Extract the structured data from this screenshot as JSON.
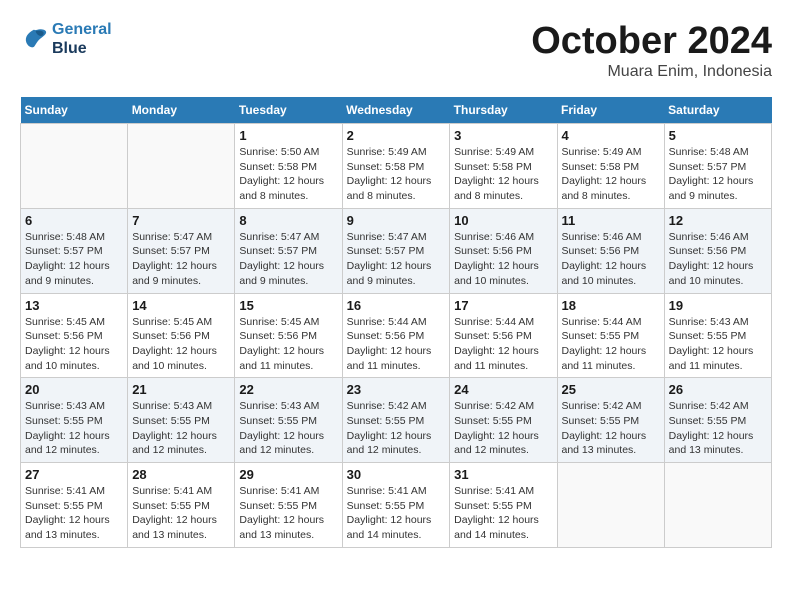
{
  "header": {
    "logo_line1": "General",
    "logo_line2": "Blue",
    "month": "October 2024",
    "location": "Muara Enim, Indonesia"
  },
  "weekdays": [
    "Sunday",
    "Monday",
    "Tuesday",
    "Wednesday",
    "Thursday",
    "Friday",
    "Saturday"
  ],
  "weeks": [
    [
      {
        "day": "",
        "info": ""
      },
      {
        "day": "",
        "info": ""
      },
      {
        "day": "1",
        "info": "Sunrise: 5:50 AM\nSunset: 5:58 PM\nDaylight: 12 hours and 8 minutes."
      },
      {
        "day": "2",
        "info": "Sunrise: 5:49 AM\nSunset: 5:58 PM\nDaylight: 12 hours and 8 minutes."
      },
      {
        "day": "3",
        "info": "Sunrise: 5:49 AM\nSunset: 5:58 PM\nDaylight: 12 hours and 8 minutes."
      },
      {
        "day": "4",
        "info": "Sunrise: 5:49 AM\nSunset: 5:58 PM\nDaylight: 12 hours and 8 minutes."
      },
      {
        "day": "5",
        "info": "Sunrise: 5:48 AM\nSunset: 5:57 PM\nDaylight: 12 hours and 9 minutes."
      }
    ],
    [
      {
        "day": "6",
        "info": "Sunrise: 5:48 AM\nSunset: 5:57 PM\nDaylight: 12 hours and 9 minutes."
      },
      {
        "day": "7",
        "info": "Sunrise: 5:47 AM\nSunset: 5:57 PM\nDaylight: 12 hours and 9 minutes."
      },
      {
        "day": "8",
        "info": "Sunrise: 5:47 AM\nSunset: 5:57 PM\nDaylight: 12 hours and 9 minutes."
      },
      {
        "day": "9",
        "info": "Sunrise: 5:47 AM\nSunset: 5:57 PM\nDaylight: 12 hours and 9 minutes."
      },
      {
        "day": "10",
        "info": "Sunrise: 5:46 AM\nSunset: 5:56 PM\nDaylight: 12 hours and 10 minutes."
      },
      {
        "day": "11",
        "info": "Sunrise: 5:46 AM\nSunset: 5:56 PM\nDaylight: 12 hours and 10 minutes."
      },
      {
        "day": "12",
        "info": "Sunrise: 5:46 AM\nSunset: 5:56 PM\nDaylight: 12 hours and 10 minutes."
      }
    ],
    [
      {
        "day": "13",
        "info": "Sunrise: 5:45 AM\nSunset: 5:56 PM\nDaylight: 12 hours and 10 minutes."
      },
      {
        "day": "14",
        "info": "Sunrise: 5:45 AM\nSunset: 5:56 PM\nDaylight: 12 hours and 10 minutes."
      },
      {
        "day": "15",
        "info": "Sunrise: 5:45 AM\nSunset: 5:56 PM\nDaylight: 12 hours and 11 minutes."
      },
      {
        "day": "16",
        "info": "Sunrise: 5:44 AM\nSunset: 5:56 PM\nDaylight: 12 hours and 11 minutes."
      },
      {
        "day": "17",
        "info": "Sunrise: 5:44 AM\nSunset: 5:56 PM\nDaylight: 12 hours and 11 minutes."
      },
      {
        "day": "18",
        "info": "Sunrise: 5:44 AM\nSunset: 5:55 PM\nDaylight: 12 hours and 11 minutes."
      },
      {
        "day": "19",
        "info": "Sunrise: 5:43 AM\nSunset: 5:55 PM\nDaylight: 12 hours and 11 minutes."
      }
    ],
    [
      {
        "day": "20",
        "info": "Sunrise: 5:43 AM\nSunset: 5:55 PM\nDaylight: 12 hours and 12 minutes."
      },
      {
        "day": "21",
        "info": "Sunrise: 5:43 AM\nSunset: 5:55 PM\nDaylight: 12 hours and 12 minutes."
      },
      {
        "day": "22",
        "info": "Sunrise: 5:43 AM\nSunset: 5:55 PM\nDaylight: 12 hours and 12 minutes."
      },
      {
        "day": "23",
        "info": "Sunrise: 5:42 AM\nSunset: 5:55 PM\nDaylight: 12 hours and 12 minutes."
      },
      {
        "day": "24",
        "info": "Sunrise: 5:42 AM\nSunset: 5:55 PM\nDaylight: 12 hours and 12 minutes."
      },
      {
        "day": "25",
        "info": "Sunrise: 5:42 AM\nSunset: 5:55 PM\nDaylight: 12 hours and 13 minutes."
      },
      {
        "day": "26",
        "info": "Sunrise: 5:42 AM\nSunset: 5:55 PM\nDaylight: 12 hours and 13 minutes."
      }
    ],
    [
      {
        "day": "27",
        "info": "Sunrise: 5:41 AM\nSunset: 5:55 PM\nDaylight: 12 hours and 13 minutes."
      },
      {
        "day": "28",
        "info": "Sunrise: 5:41 AM\nSunset: 5:55 PM\nDaylight: 12 hours and 13 minutes."
      },
      {
        "day": "29",
        "info": "Sunrise: 5:41 AM\nSunset: 5:55 PM\nDaylight: 12 hours and 13 minutes."
      },
      {
        "day": "30",
        "info": "Sunrise: 5:41 AM\nSunset: 5:55 PM\nDaylight: 12 hours and 14 minutes."
      },
      {
        "day": "31",
        "info": "Sunrise: 5:41 AM\nSunset: 5:55 PM\nDaylight: 12 hours and 14 minutes."
      },
      {
        "day": "",
        "info": ""
      },
      {
        "day": "",
        "info": ""
      }
    ]
  ]
}
